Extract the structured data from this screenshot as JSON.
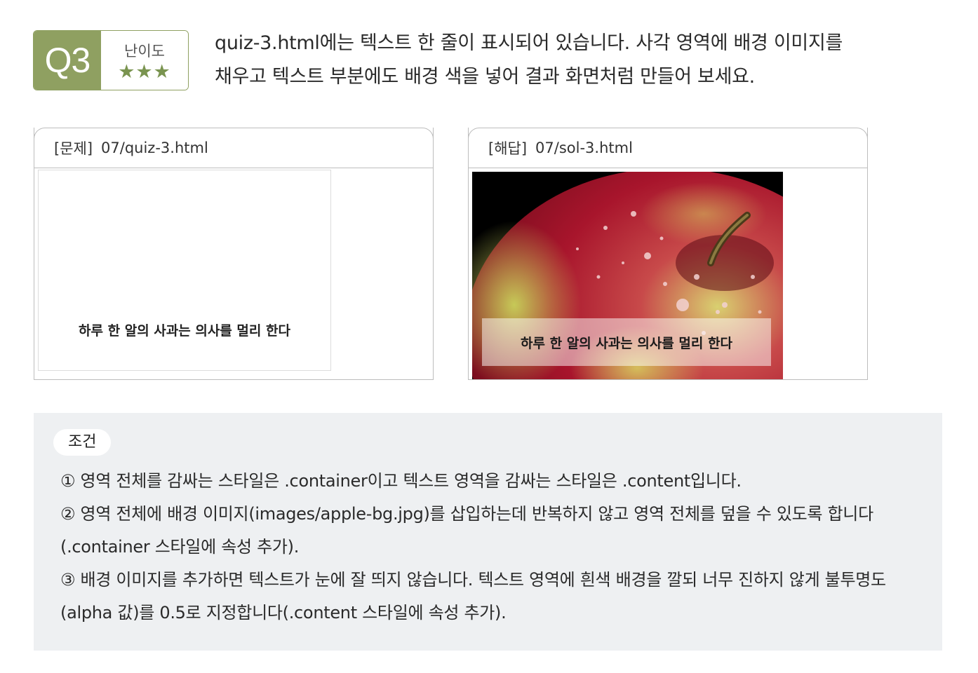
{
  "badge": {
    "number": "Q3",
    "difficulty_label": "난이도",
    "difficulty_stars": "★★★",
    "accent_color": "#8fa061"
  },
  "question": {
    "line1": "quiz-3.html에는 텍스트 한 줄이 표시되어 있습니다. 사각 영역에 배경 이미지를",
    "line2": "채우고 텍스트 부분에도 배경 색을 넣어 결과 화면처럼 만들어 보세요."
  },
  "quiz_panel": {
    "tag": "[문제]",
    "file": "07/quiz-3.html",
    "content_text": "하루 한 알의 사과는 의사를 멀리 한다"
  },
  "solution_panel": {
    "tag": "[해답]",
    "file": "07/sol-3.html",
    "content_text": "하루 한 알의 사과는 의사를 멀리 한다",
    "image": "apple-photo"
  },
  "conditions": {
    "title": "조건",
    "items": [
      "① 영역 전체를 감싸는 스타일은 .container이고 텍스트 영역을 감싸는 스타일은 .content입니다.",
      "② 영역 전체에 배경 이미지(images/apple-bg.jpg)를 삽입하는데 반복하지 않고 영역 전체를 덮을 수 있도록 합니다(.container 스타일에 속성 추가).",
      "③ 배경 이미지를 추가하면 텍스트가 눈에 잘 띄지 않습니다. 텍스트 영역에 흰색 배경을 깔되 너무 진하지 않게 불투명도(alpha 값)를 0.5로 지정합니다(.content 스타일에 속성 추가)."
    ]
  }
}
